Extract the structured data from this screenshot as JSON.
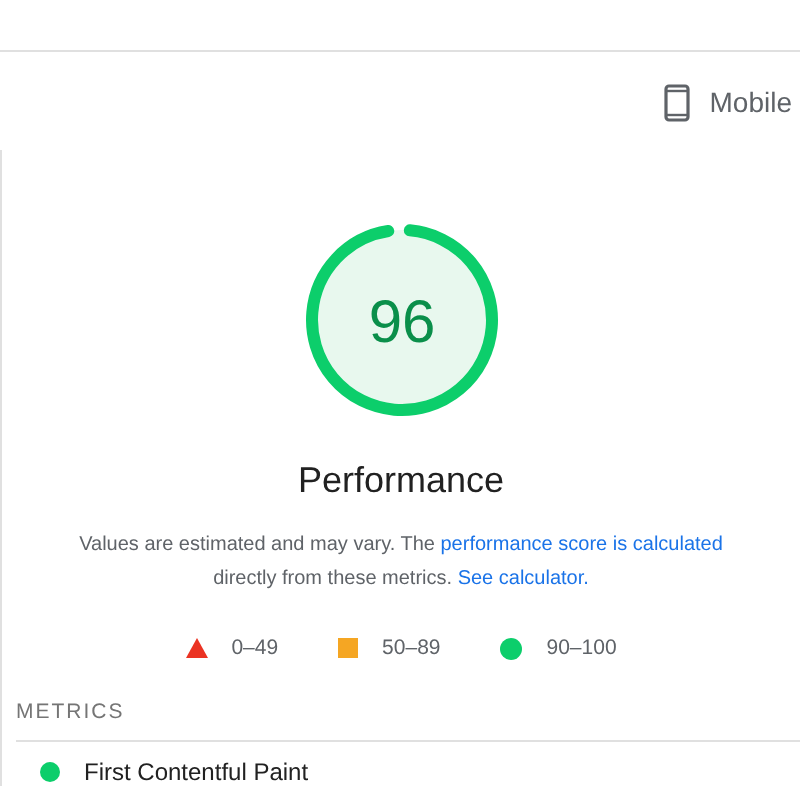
{
  "device": {
    "label": "Mobile"
  },
  "gauge": {
    "score": "96",
    "level": 0.96,
    "title": "Performance"
  },
  "note": {
    "before": "Values are estimated and may vary. The ",
    "link1": "performance score is calculated",
    "middle": " directly from these metrics. ",
    "link2": "See calculator."
  },
  "legend": [
    {
      "kind": "triangle",
      "label": "0–49",
      "color": "#eb3323"
    },
    {
      "kind": "square",
      "label": "50–89",
      "color": "#f5a623"
    },
    {
      "kind": "circle",
      "label": "90–100",
      "color": "#0cce6b"
    }
  ],
  "metrics_heading": "METRICS",
  "metrics": [
    {
      "name": "First Contentful Paint",
      "color": "#0cce6b"
    }
  ]
}
